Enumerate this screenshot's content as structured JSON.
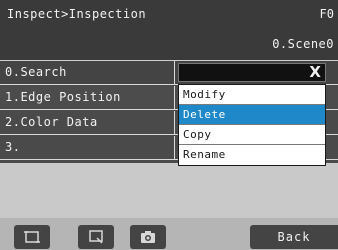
{
  "header": {
    "breadcrumb": "Inspect>Inspection",
    "top_right": "F0",
    "scene_label": "0.Scene0"
  },
  "scene_list": {
    "rows": [
      {
        "label": "0.Search"
      },
      {
        "label": "1.Edge Position"
      },
      {
        "label": "2.Color Data"
      },
      {
        "label": "3."
      }
    ]
  },
  "context_menu": {
    "items": [
      "Modify",
      "Delete",
      "Copy",
      "Rename"
    ],
    "selected": "Delete",
    "close_symbol": "X"
  },
  "footer": {
    "icons": [
      "fit-screen-icon",
      "zoom-icon",
      "camera-icon"
    ],
    "back_label": "Back"
  },
  "colors": {
    "header_bg": "#3a3a3a",
    "selected_bg": "#1e88c8",
    "menu_bg": "#ffffff"
  }
}
